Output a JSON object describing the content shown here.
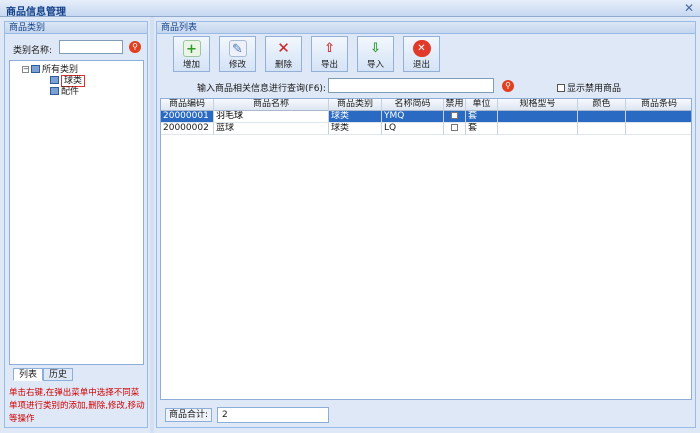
{
  "window": {
    "title": "商品信息管理",
    "close_glyph": "✕"
  },
  "left": {
    "header": "商品类别",
    "category_label": "类别名称:",
    "category_value": "",
    "tree": [
      {
        "label": "所有类别",
        "expander": "⊟"
      },
      {
        "label": "球类",
        "selected": true
      },
      {
        "label": "配件"
      }
    ],
    "tabs": [
      "列表",
      "历史"
    ],
    "hint": "单击右键,在弹出菜单中选择不同菜单项进行类别的添加,删除,修改,移动等操作"
  },
  "right": {
    "header": "商品列表",
    "toolbar": [
      {
        "label": "增加",
        "icon": "add-icon",
        "glyph": "+",
        "color": "#2f9b2f"
      },
      {
        "label": "修改",
        "icon": "edit-icon",
        "glyph": "✎",
        "color": "#4a78b8"
      },
      {
        "label": "删除",
        "icon": "delete-icon",
        "glyph": "✕",
        "color": "#d02020"
      },
      {
        "label": "导出",
        "icon": "export-icon",
        "glyph": "⇧",
        "color": "#d03030"
      },
      {
        "label": "导入",
        "icon": "import-icon",
        "glyph": "⇩",
        "color": "#2f9b2f"
      },
      {
        "label": "退出",
        "icon": "exit-icon",
        "glyph": "✕",
        "color": "#ffffff"
      }
    ],
    "query_label": "输入商品相关信息进行查询(F6):",
    "query_value": "",
    "show_disabled_label": "显示禁用商品",
    "columns": [
      "商品编码",
      "商品名称",
      "商品类别",
      "名称简码",
      "禁用",
      "单位",
      "规格型号",
      "颜色",
      "商品条码"
    ],
    "rows": [
      {
        "code": "20000001",
        "name": "羽毛球",
        "category": "球类",
        "abbr": "YMQ",
        "unit": "套",
        "spec": "",
        "color": "",
        "barcode": ""
      },
      {
        "code": "20000002",
        "name": "篮球",
        "category": "球类",
        "abbr": "LQ",
        "unit": "套",
        "spec": "",
        "color": "",
        "barcode": ""
      }
    ],
    "footer_label": "商品合计:",
    "footer_value": "2"
  },
  "colors": {
    "accent": "#2a6ac3",
    "panel_bg": "#dfe8f6",
    "border": "#99bbe8",
    "hint": "#d00000"
  }
}
